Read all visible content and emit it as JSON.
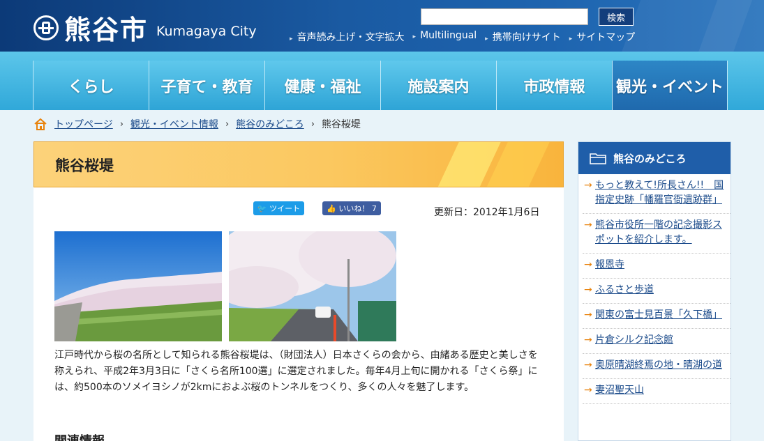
{
  "header": {
    "logo_jp": "熊谷市",
    "logo_en": "Kumagaya City",
    "search_button": "検索",
    "utility_links": [
      "音声読み上げ・文字拡大",
      "Multilingual",
      "携帯向けサイト",
      "サイトマップ"
    ]
  },
  "global_nav": {
    "items": [
      "くらし",
      "子育て・教育",
      "健康・福祉",
      "施設案内",
      "市政情報",
      "観光・イベント"
    ],
    "active_index": 5
  },
  "breadcrumb": {
    "links": [
      "トップページ",
      "観光・イベント情報",
      "熊谷のみどころ"
    ],
    "current": "熊谷桜堤"
  },
  "page": {
    "title": "熊谷桜堤",
    "tweet_label": "ツイート",
    "like_label": "いいね！ 7",
    "updated": "更新日：2012年1月6日",
    "body": "江戸時代から桜の名所として知られる熊谷桜堤は、（財団法人）日本さくらの会から、由緒ある歴史と美しさを称えられ、平成2年3月3日に「さくら名所100選」に選定されました。毎年4月上旬に開かれる「さくら祭」には、約500本のソメイヨシノが2kmにおよぶ桜のトンネルをつくり、多くの人々を魅了します。",
    "section_heading": "関連情報"
  },
  "sidebar": {
    "title": "熊谷のみどころ",
    "items": [
      "もっと教えて!所長さん!!　国指定史跡「幡羅官衙遺跡群」",
      "熊谷市役所一階の記念撮影スポットを紹介します。",
      "報恩寺",
      "ふるさと歩道",
      "関東の富士見百景「久下橋」",
      "片倉シルク記念館",
      "奥原晴湖終焉の地・晴湖の道",
      "妻沼聖天山"
    ]
  },
  "colors": {
    "header_blue": "#1a5aa2",
    "nav_cyan": "#30a8d9",
    "title_orange": "#fbc860",
    "link": "#1a4a8a",
    "arrow_orange": "#e8820c"
  }
}
